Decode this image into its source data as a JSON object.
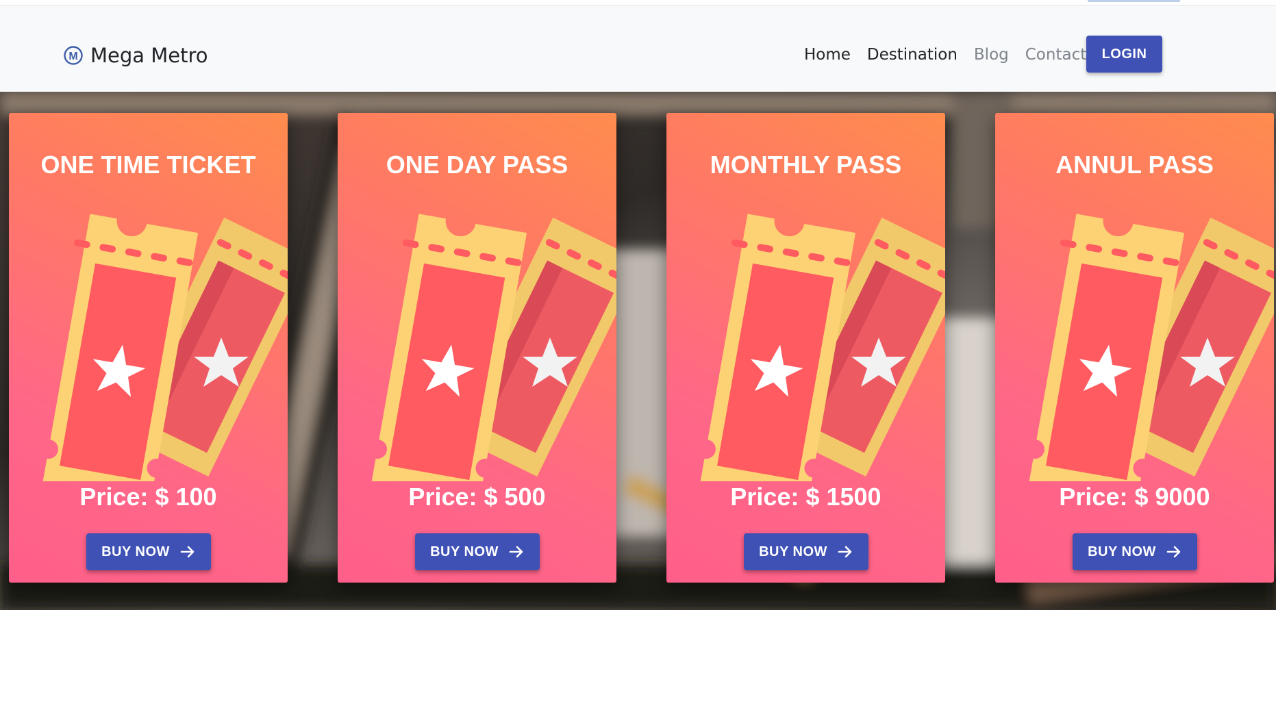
{
  "brand": {
    "name": "Mega Metro",
    "logo_icon": "m-circle-logo-icon"
  },
  "nav": {
    "links": [
      {
        "label": "Home",
        "active": true
      },
      {
        "label": "Destination",
        "active": true
      },
      {
        "label": "Blog",
        "active": false
      },
      {
        "label": "Contact",
        "active": false
      }
    ],
    "login_label": "LOGIN"
  },
  "cards": [
    {
      "title": "ONE TIME TICKET",
      "price_label": "Price:",
      "price": "$ 100",
      "button": "BUY NOW"
    },
    {
      "title": "ONE DAY PASS",
      "price_label": "Price:",
      "price": "$ 500",
      "button": "BUY NOW"
    },
    {
      "title": "MONTHLY PASS",
      "price_label": "Price:",
      "price": "$ 1500",
      "button": "BUY NOW"
    },
    {
      "title": "ANNUL PASS",
      "price_label": "Price:",
      "price": "$ 9000",
      "button": "BUY NOW"
    }
  ],
  "icons": {
    "ticket": "ticket-star-icon",
    "arrow": "arrow-right-icon"
  },
  "colors": {
    "primary": "#3f51b5",
    "card_gradient_start": "#ff8c4e",
    "card_gradient_end": "#ff5f8a",
    "ticket_gold": "#fdd274",
    "ticket_red": "#ff5b60"
  }
}
